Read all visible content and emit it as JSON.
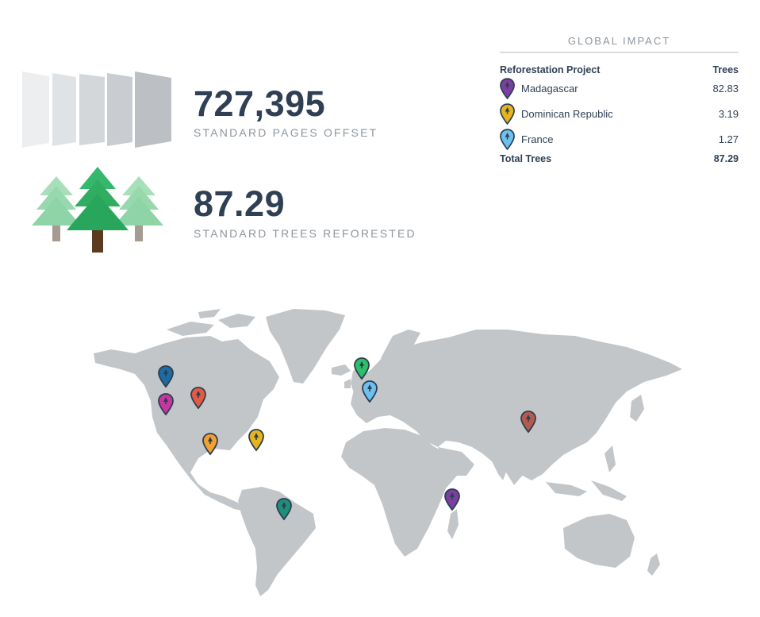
{
  "stats": {
    "pages_value": "727,395",
    "pages_label": "STANDARD PAGES OFFSET",
    "trees_value": "87.29",
    "trees_label": "STANDARD TREES REFORESTED"
  },
  "impact": {
    "title": "GLOBAL IMPACT",
    "col_project": "Reforestation Project",
    "col_trees": "Trees",
    "rows": [
      {
        "name": "Madagascar",
        "value": "82.83",
        "color": "#7b3fa0"
      },
      {
        "name": "Dominican Republic",
        "value": "3.19",
        "color": "#e6b41e"
      },
      {
        "name": "France",
        "value": "1.27",
        "color": "#6ec0ee"
      }
    ],
    "total_label": "Total Trees",
    "total_value": "87.29"
  },
  "map_pins": [
    {
      "region": "pacific-northwest",
      "color": "#1f6aa3"
    },
    {
      "region": "california",
      "color": "#c6379f"
    },
    {
      "region": "rocky-mountains",
      "color": "#e45a42"
    },
    {
      "region": "mexico",
      "color": "#f0a131"
    },
    {
      "region": "caribbean",
      "color": "#e6b41e"
    },
    {
      "region": "brazil",
      "color": "#1f8f7a"
    },
    {
      "region": "ireland",
      "color": "#2ec068"
    },
    {
      "region": "france",
      "color": "#6ec0ee"
    },
    {
      "region": "madagascar",
      "color": "#7b3fa0"
    },
    {
      "region": "china",
      "color": "#b65a4c"
    }
  ],
  "colors": {
    "map_land": "#c3c6c9",
    "pin_outline": "#2c3e50",
    "tree_dark": "#27ae60",
    "tree_light": "#8fd4a6"
  }
}
